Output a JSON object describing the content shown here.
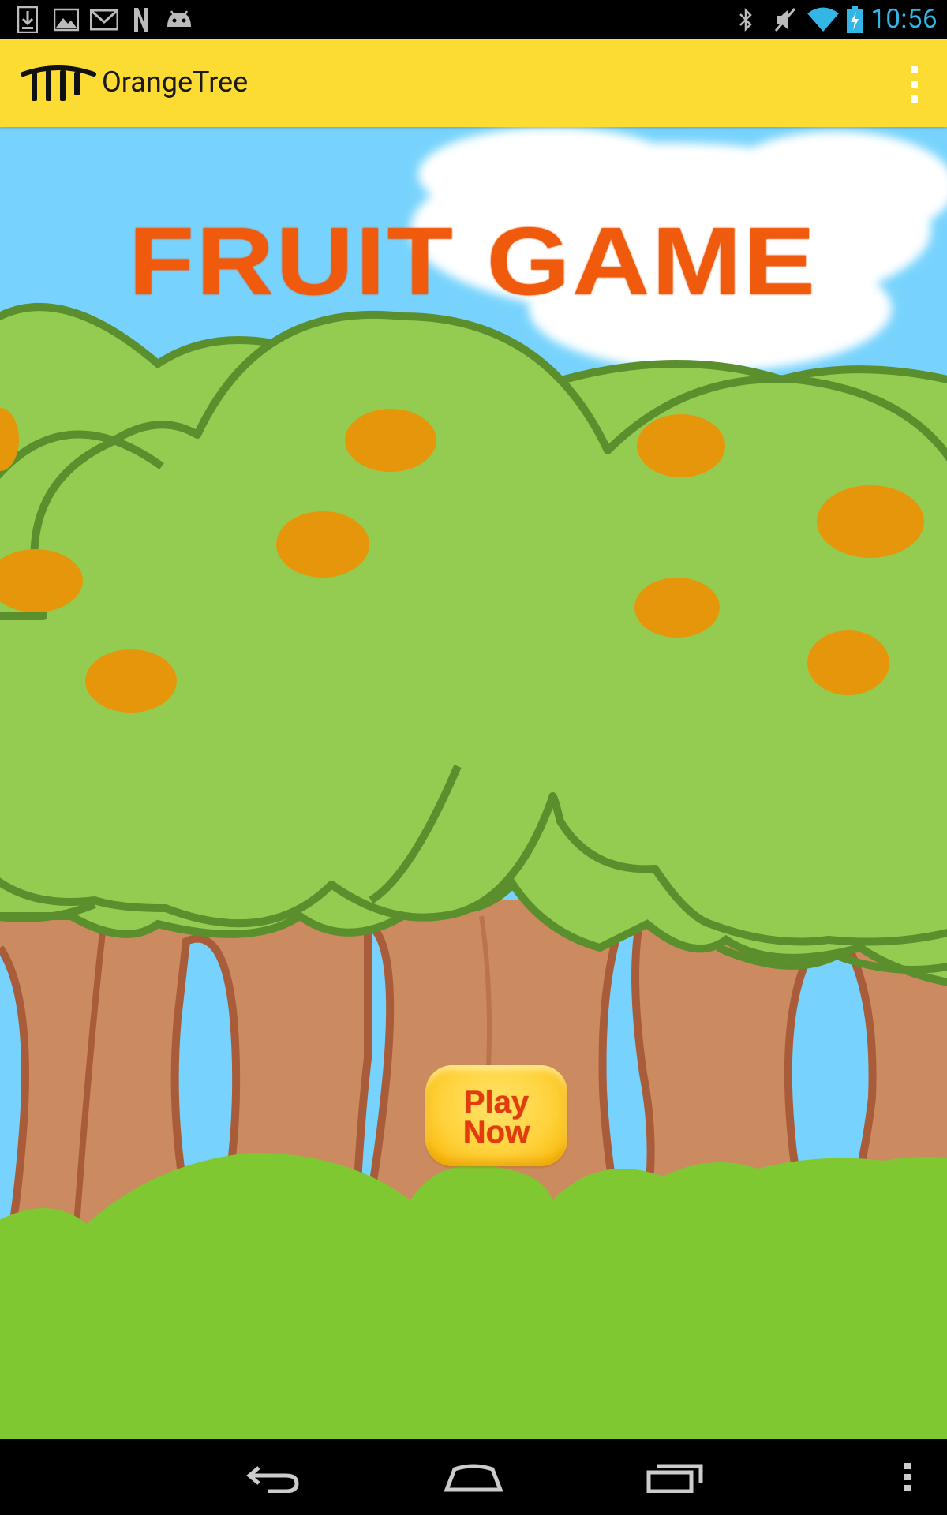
{
  "status_bar": {
    "time": "10:56",
    "notification_icons": [
      "download-icon",
      "image-icon",
      "gmail-icon",
      "n-app-icon",
      "android-icon"
    ],
    "system_icons": [
      "bluetooth-icon",
      "mute-icon",
      "wifi-icon",
      "battery-charging-icon"
    ]
  },
  "action_bar": {
    "app_title": "OrangeTree",
    "logo_icon": "orangetree-logo-icon",
    "menu_icon": "overflow-menu-icon",
    "background_color": "#fcdb33"
  },
  "game": {
    "title": "FRUIT GAME",
    "title_color": "#f05a0c",
    "play_button_label": "Play\nNow",
    "play_button_label_color": "#e33b0d",
    "sky_color": "#77d3fd",
    "leaf_color": "#94cc52",
    "orange_color": "#e6960a",
    "trunk_color": "#cc8a60",
    "grass_color": "#7fc832"
  },
  "nav_bar": {
    "buttons": [
      "back-icon",
      "home-icon",
      "recents-icon",
      "menu-icon"
    ]
  }
}
